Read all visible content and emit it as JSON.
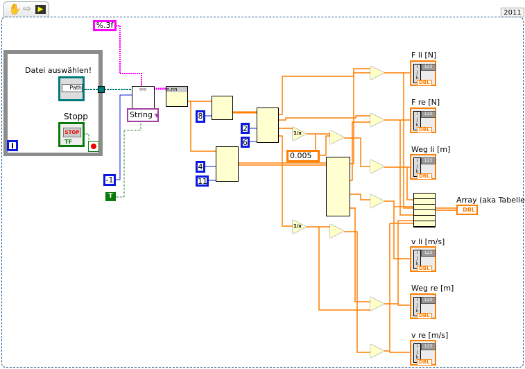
{
  "toolbar": {
    "icons": [
      "hand-icon",
      "arrow-icon",
      "run-highlight-icon"
    ]
  },
  "version_label": "2011",
  "loop": {
    "path_label": "Datei auswählen!",
    "path_text": "Path",
    "stop_label": "Stopp",
    "stop_text": "STOP",
    "tf_text": "TF",
    "iteration_text": "i"
  },
  "constants": {
    "format": "%.3f",
    "minus_one": "-1",
    "true_const": "T",
    "index8": "8",
    "index2": "2",
    "index6": "6",
    "index4": "4",
    "index11": "11",
    "dt": "0.005",
    "ring": "String"
  },
  "nodes": {
    "format_label": "n.nn",
    "recip": "1/x",
    "divide": "÷",
    "subtract": "−",
    "multiply": "×"
  },
  "indicators": [
    {
      "label": "F li  [N]",
      "type": "DBL"
    },
    {
      "label": "F re [N]",
      "type": "DBL"
    },
    {
      "label": "Weg li [m]",
      "type": "DBL"
    },
    {
      "label": "v li [m/s]",
      "type": "DBL"
    },
    {
      "label": "Weg re [m]",
      "type": "DBL"
    },
    {
      "label": "v re [m/s]",
      "type": "DBL"
    }
  ],
  "array_indicator": {
    "label": "Array (aka Tabelle)",
    "type": "DBL"
  },
  "colors": {
    "numeric_wire": "#ff7f00",
    "string_wire": "#ff00ff",
    "path_wire": "#007a7a",
    "int_wire": "#0a18e0",
    "bool_wire": "#006400",
    "loop": "#8c8c8c"
  }
}
